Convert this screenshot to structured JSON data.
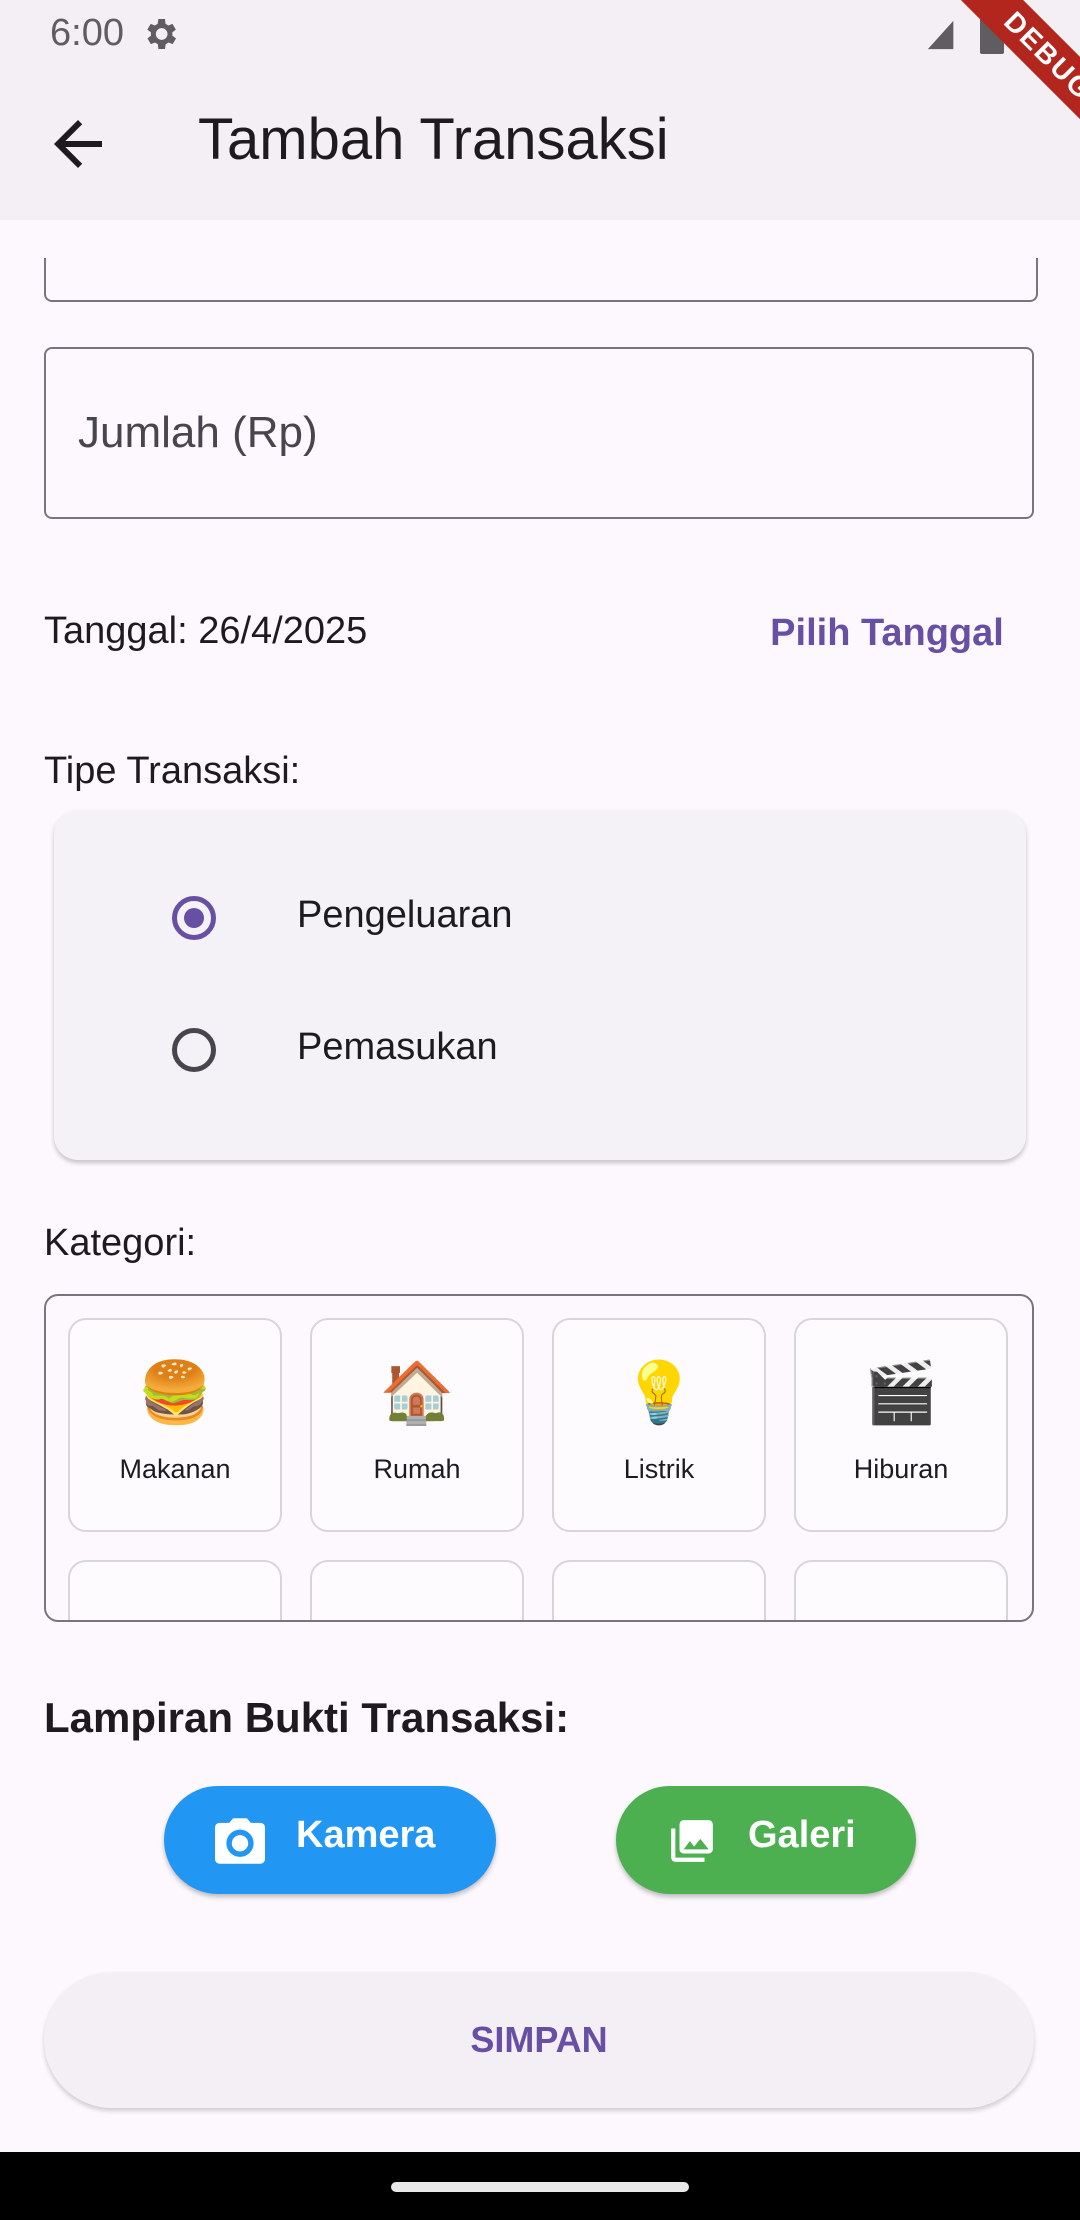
{
  "status_bar": {
    "time": "6:00"
  },
  "debug_banner": "DEBUG",
  "app_bar": {
    "title": "Tambah Transaksi"
  },
  "form": {
    "amount_placeholder": "Jumlah (Rp)",
    "date_text": "Tanggal: 26/4/2025",
    "pick_date_label": "Pilih Tanggal",
    "type_label": "Tipe Transaksi:",
    "type_options": [
      {
        "label": "Pengeluaran",
        "selected": true
      },
      {
        "label": "Pemasukan",
        "selected": false
      }
    ],
    "category_label": "Kategori:",
    "categories": [
      {
        "emoji": "🍔",
        "label": "Makanan"
      },
      {
        "emoji": "🏠",
        "label": "Rumah"
      },
      {
        "emoji": "💡",
        "label": "Listrik"
      },
      {
        "emoji": "🎬",
        "label": "Hiburan"
      }
    ],
    "attachment_label": "Lampiran Bukti Transaksi:",
    "camera_label": "Kamera",
    "gallery_label": "Galeri",
    "save_label": "SIMPAN"
  },
  "colors": {
    "primary": "#6750a4",
    "camera_button": "#2196f3",
    "gallery_button": "#4caf50",
    "debug_ribbon": "#b3261e"
  },
  "icons": [
    "settings-gear-icon",
    "signal-icon",
    "battery-icon",
    "back-arrow-icon",
    "camera-icon",
    "gallery-icon"
  ]
}
